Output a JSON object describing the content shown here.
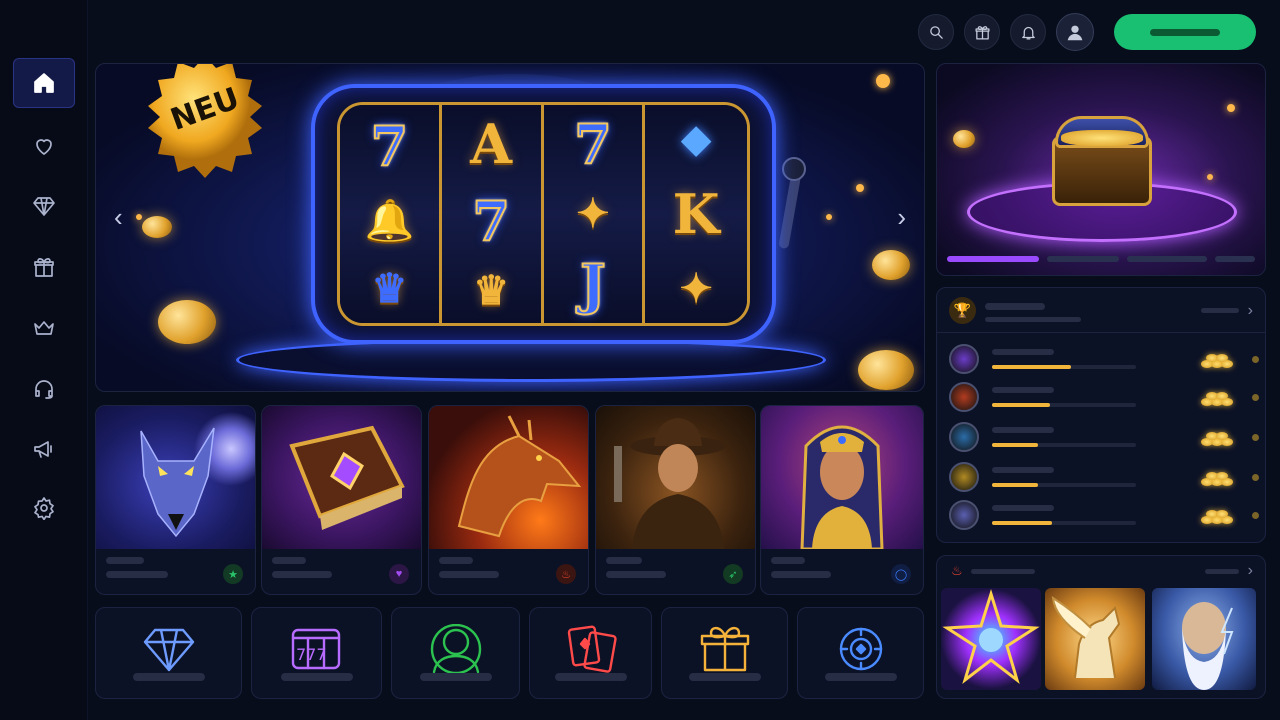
{
  "sidebar": {
    "items": [
      {
        "icon": "home-icon",
        "active": true
      },
      {
        "icon": "heart-icon"
      },
      {
        "icon": "diamond-icon"
      },
      {
        "icon": "gift-icon"
      },
      {
        "icon": "crown-icon"
      },
      {
        "icon": "headset-icon"
      },
      {
        "icon": "megaphone-icon"
      },
      {
        "icon": "gear-icon"
      }
    ]
  },
  "header": {
    "buttons": [
      "search-icon",
      "gift-icon",
      "bell-icon",
      "user-icon"
    ],
    "cta_color": "#19c072"
  },
  "hero": {
    "badge": "NEU",
    "reels": [
      [
        "7",
        "🔔",
        "♛"
      ],
      [
        "A",
        "7",
        "♛"
      ],
      [
        "7",
        "✦",
        "J"
      ],
      [
        "◆",
        "K",
        "✦"
      ]
    ]
  },
  "games": [
    {
      "name": "wolf",
      "icon": "star-icon",
      "icon_color": "#29c46a"
    },
    {
      "name": "book",
      "icon": "heart-icon",
      "icon_color": "#a24cf0"
    },
    {
      "name": "dragon",
      "icon": "fire-icon",
      "icon_color": "#e9452c"
    },
    {
      "name": "cowboy",
      "icon": "rocket-icon",
      "icon_color": "#29c46a"
    },
    {
      "name": "cleopatra",
      "icon": "circle-icon",
      "icon_color": "#3a7bff"
    }
  ],
  "categories": [
    {
      "icon": "diamond-icon",
      "color": "#6d9bff"
    },
    {
      "icon": "slot-777-icon",
      "color": "#b76cff"
    },
    {
      "icon": "user-icon",
      "color": "#2cc24f"
    },
    {
      "icon": "cards-icon",
      "color": "#ff4a4a"
    },
    {
      "icon": "gift-icon",
      "color": "#f5b23a"
    },
    {
      "icon": "chip-icon",
      "color": "#4a8bff"
    }
  ],
  "leaderboard": {
    "rows": [
      {
        "progress": 0.55,
        "avatar_color": "#6b3cc8"
      },
      {
        "progress": 0.4,
        "avatar_color": "#b23c20"
      },
      {
        "progress": 0.32,
        "avatar_color": "#2b6ca8"
      },
      {
        "progress": 0.32,
        "avatar_color": "#b08a22"
      },
      {
        "progress": 0.42,
        "avatar_color": "#5a5fb0"
      }
    ]
  },
  "rewards": {
    "progress_segments": 4,
    "active_segment": 1
  }
}
